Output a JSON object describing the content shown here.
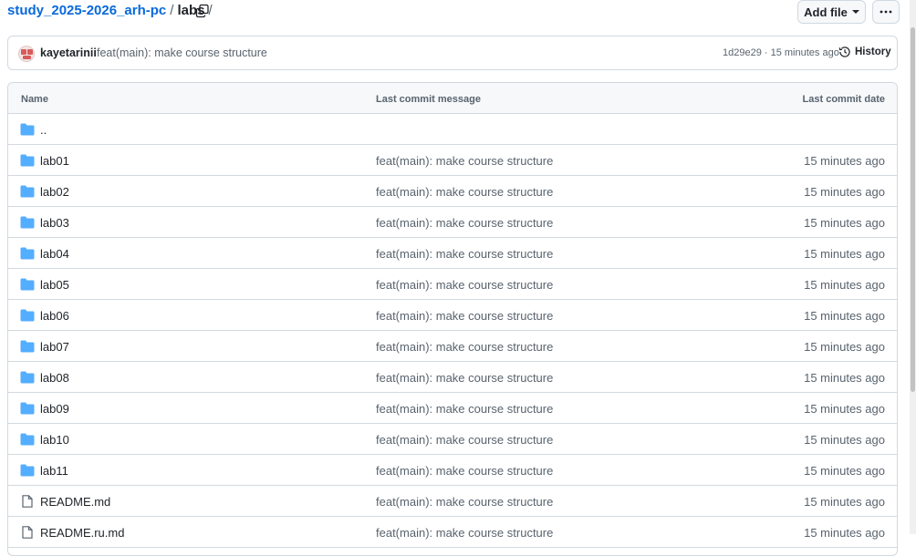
{
  "breadcrumb": {
    "repo": "study_2025-2026_arh-pc",
    "sep1": "/",
    "current": "labs",
    "sep2": "/"
  },
  "toolbar": {
    "add_file_label": "Add file",
    "more_icon": "kebab-horizontal-icon",
    "copy_icon": "copy-icon"
  },
  "commit": {
    "author": "kayetarinii",
    "message": "feat(main): make course structure",
    "meta": "1d29e29 · 15 minutes ago",
    "history_label": "History",
    "history_icon": "history-clock-icon"
  },
  "table": {
    "headers": {
      "name": "Name",
      "message": "Last commit message",
      "date": "Last commit date"
    },
    "parent": {
      "name": "..",
      "icon": "folder-icon"
    },
    "rows": [
      {
        "name": "lab01",
        "type": "folder",
        "message": "feat(main): make course structure",
        "date": "15 minutes ago"
      },
      {
        "name": "lab02",
        "type": "folder",
        "message": "feat(main): make course structure",
        "date": "15 minutes ago"
      },
      {
        "name": "lab03",
        "type": "folder",
        "message": "feat(main): make course structure",
        "date": "15 minutes ago"
      },
      {
        "name": "lab04",
        "type": "folder",
        "message": "feat(main): make course structure",
        "date": "15 minutes ago"
      },
      {
        "name": "lab05",
        "type": "folder",
        "message": "feat(main): make course structure",
        "date": "15 minutes ago"
      },
      {
        "name": "lab06",
        "type": "folder",
        "message": "feat(main): make course structure",
        "date": "15 minutes ago"
      },
      {
        "name": "lab07",
        "type": "folder",
        "message": "feat(main): make course structure",
        "date": "15 minutes ago"
      },
      {
        "name": "lab08",
        "type": "folder",
        "message": "feat(main): make course structure",
        "date": "15 minutes ago"
      },
      {
        "name": "lab09",
        "type": "folder",
        "message": "feat(main): make course structure",
        "date": "15 minutes ago"
      },
      {
        "name": "lab10",
        "type": "folder",
        "message": "feat(main): make course structure",
        "date": "15 minutes ago"
      },
      {
        "name": "lab11",
        "type": "folder",
        "message": "feat(main): make course structure",
        "date": "15 minutes ago"
      },
      {
        "name": "README.md",
        "type": "file",
        "message": "feat(main): make course structure",
        "date": "15 minutes ago"
      },
      {
        "name": "README.ru.md",
        "type": "file",
        "message": "feat(main): make course structure",
        "date": "15 minutes ago"
      }
    ]
  },
  "colors": {
    "link": "#0969da",
    "folder": "#54aeff",
    "muted": "#59636e",
    "border": "#d1d9e0"
  }
}
